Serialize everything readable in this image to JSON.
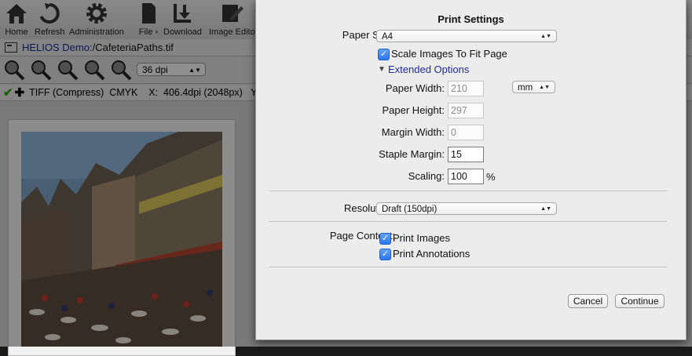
{
  "toolbar": {
    "items": [
      {
        "label": "Home",
        "icon": "house-icon"
      },
      {
        "label": "Refresh",
        "icon": "refresh-icon"
      },
      {
        "label": "Administration",
        "icon": "gear-icon"
      },
      {
        "label": "File ›",
        "icon": "document-icon"
      },
      {
        "label": "Download",
        "icon": "download-icon"
      },
      {
        "label": "Image Edito",
        "icon": "edit-icon"
      }
    ]
  },
  "pathbar": {
    "server": "HELIOS Demo:",
    "path": " /CafeteriaPaths.tif"
  },
  "zoom": {
    "buttons": [
      "1",
      "2",
      "3",
      "4",
      ""
    ],
    "dpi": "36 dpi"
  },
  "info": {
    "text": "TIFF (Compress)  CMYK    X:  406.4dpi (2048px)   Y:"
  },
  "dialog": {
    "title": "Print Settings",
    "paper_size_label": "Paper Size:",
    "paper_size_value": "A4",
    "scale_label": "Scale Images To Fit Page",
    "extended_label": "Extended Options",
    "paper_width_label": "Paper Width:",
    "paper_width_value": "210",
    "unit_value": "mm",
    "paper_height_label": "Paper Height:",
    "paper_height_value": "297",
    "margin_width_label": "Margin Width:",
    "margin_width_value": "0",
    "staple_margin_label": "Staple Margin:",
    "staple_margin_value": "15",
    "scaling_label": "Scaling:",
    "scaling_value": "100",
    "scaling_unit": "%",
    "resolution_label": "Resolution:",
    "resolution_value": "Draft (150dpi)",
    "page_content_label": "Page Content:",
    "print_images_label": "Print Images",
    "print_annotations_label": "Print Annotations",
    "cancel_label": "Cancel",
    "continue_label": "Continue"
  },
  "colors": {
    "link": "#1f2a9e",
    "checkbox": "#2b78f0",
    "check_ok": "#3aa31a"
  }
}
